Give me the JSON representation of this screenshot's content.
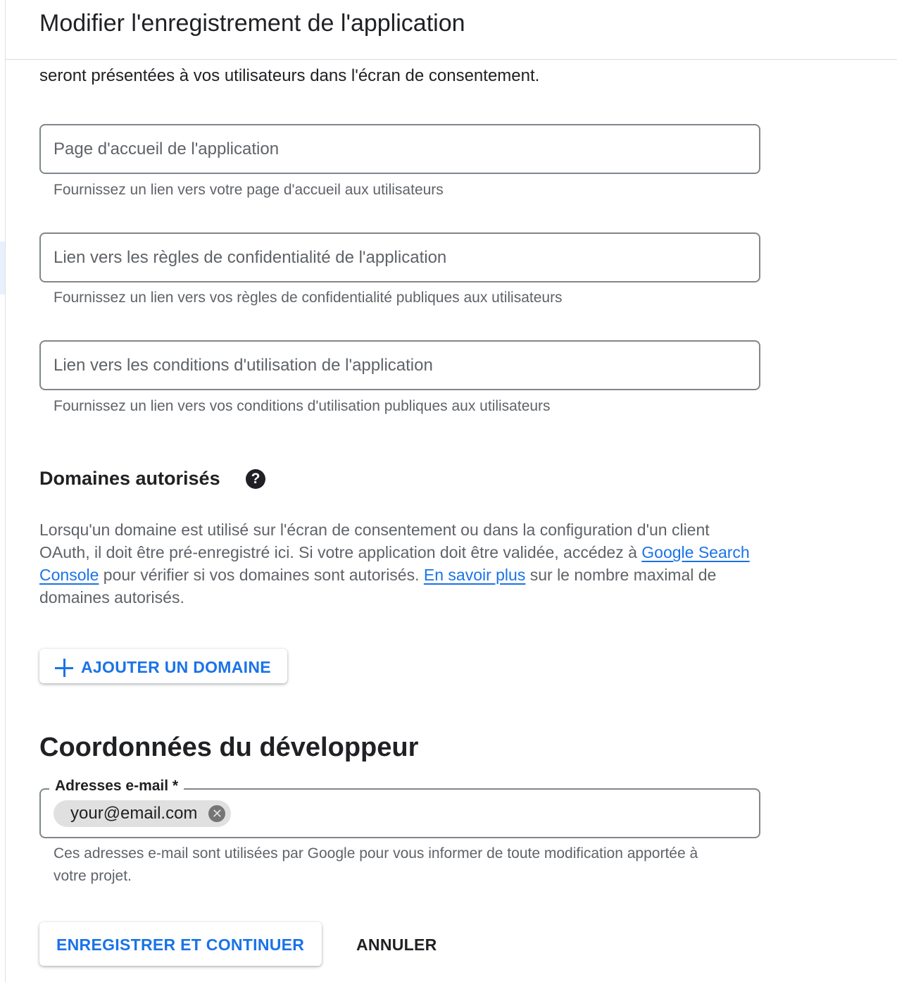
{
  "header": {
    "title": "Modifier l'enregistrement de l'application"
  },
  "intro": {
    "clipped_text": "seront présentées à vos utilisateurs dans l'écran de consentement."
  },
  "fields": {
    "homepage": {
      "placeholder": "Page d'accueil de l'application",
      "hint": "Fournissez un lien vers votre page d'accueil aux utilisateurs"
    },
    "privacy": {
      "placeholder": "Lien vers les règles de confidentialité de l'application",
      "hint": "Fournissez un lien vers vos règles de confidentialité publiques aux utilisateurs"
    },
    "terms": {
      "placeholder": "Lien vers les conditions d'utilisation de l'application",
      "hint": "Fournissez un lien vers vos conditions d'utilisation publiques aux utilisateurs"
    }
  },
  "authorized_domains": {
    "title": "Domaines autorisés",
    "help_icon": "help-circle-icon",
    "text_1": "Lorsqu'un domaine est utilisé sur l'écran de consentement ou dans la configuration d'un client OAuth, il doit être pré-enregistré ici. Si votre application doit être validée, accédez à",
    "link_1": "Google Search Console",
    "text_2": "pour vérifier si vos domaines sont autorisés.",
    "link_2": "En savoir plus",
    "text_3": "sur le nombre maximal de domaines autorisés.",
    "add_button_icon": "plus-icon",
    "add_button_label": "AJOUTER UN DOMAINE"
  },
  "developer": {
    "title": "Coordonnées du développeur",
    "email_label": "Adresses e-mail *",
    "chip_value": "your@email.com",
    "chip_remove_icon": "cancel-icon",
    "hint": "Ces adresses e-mail sont utilisées par Google pour vous informer de toute modification apportée à votre projet."
  },
  "actions": {
    "save_label": "ENREGISTRER ET CONTINUER",
    "cancel_label": "ANNULER"
  },
  "colors": {
    "accent": "#1a73e8",
    "text": "#202124",
    "secondary_text": "#5f6368",
    "border": "#80868b",
    "chip_bg": "#e0e0e0"
  }
}
